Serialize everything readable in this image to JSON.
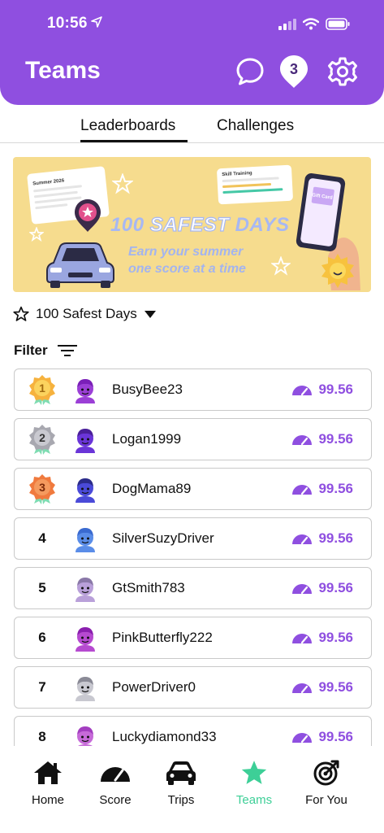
{
  "status_bar": {
    "time": "10:56"
  },
  "header": {
    "title": "Teams",
    "notification_count": "3"
  },
  "tabs": [
    {
      "label": "Leaderboards",
      "active": true
    },
    {
      "label": "Challenges",
      "active": false
    }
  ],
  "banner": {
    "title_number": "100",
    "title_word": "SAFEST",
    "title_end": "DAYS",
    "subtitle_line1": "Earn your summer",
    "subtitle_line2": "one score at a time",
    "checklist_title": "Summer 2026",
    "skill_card_title": "Skill Training",
    "gift_card_label": "Gift Card"
  },
  "challenge_selector": {
    "label": "100 Safest Days"
  },
  "filter": {
    "label": "Filter"
  },
  "leaderboard": [
    {
      "rank": "1",
      "name": "BusyBee23",
      "score": "99.56",
      "medal": "gold"
    },
    {
      "rank": "2",
      "name": "Logan1999",
      "score": "99.56",
      "medal": "silver"
    },
    {
      "rank": "3",
      "name": "DogMama89",
      "score": "99.56",
      "medal": "bronze"
    },
    {
      "rank": "4",
      "name": "SilverSuzyDriver",
      "score": "99.56",
      "medal": ""
    },
    {
      "rank": "5",
      "name": "GtSmith783",
      "score": "99.56",
      "medal": ""
    },
    {
      "rank": "6",
      "name": "PinkButterfly222",
      "score": "99.56",
      "medal": ""
    },
    {
      "rank": "7",
      "name": "PowerDriver0",
      "score": "99.56",
      "medal": ""
    },
    {
      "rank": "8",
      "name": "Luckydiamond33",
      "score": "99.56",
      "medal": ""
    }
  ],
  "nav": {
    "items": [
      {
        "label": "Home",
        "icon": "home-icon"
      },
      {
        "label": "Score",
        "icon": "speedometer-icon"
      },
      {
        "label": "Trips",
        "icon": "car-icon"
      },
      {
        "label": "Teams",
        "icon": "star-icon",
        "active": true
      },
      {
        "label": "For You",
        "icon": "target-icon"
      }
    ]
  },
  "colors": {
    "brand_purple": "#8f4fe0",
    "active_nav": "#3dcf97",
    "banner_bg": "#f6dc8e"
  }
}
